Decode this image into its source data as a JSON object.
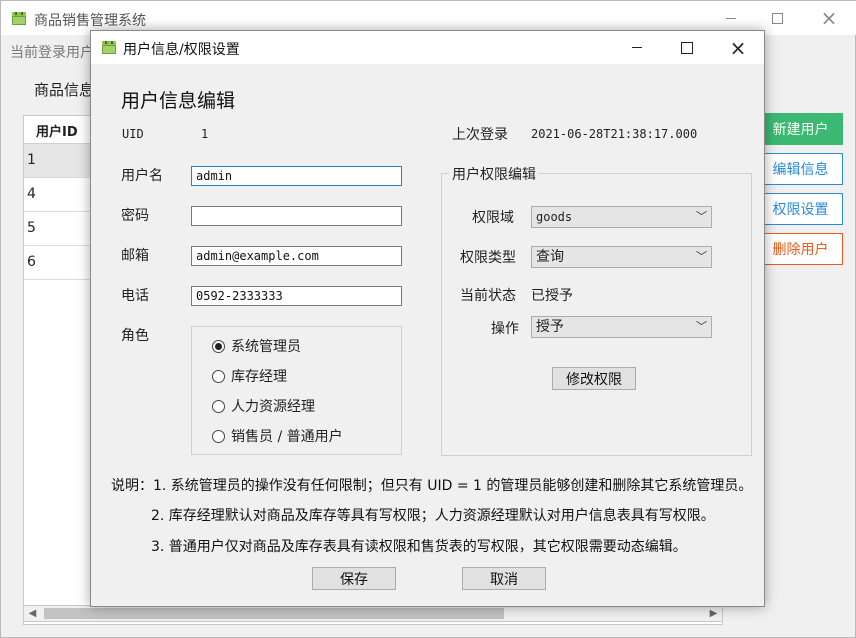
{
  "main": {
    "title": "商品销售管理系统",
    "current_user": "当前登录用户",
    "section_title": "商品信息",
    "table": {
      "header": "用户ID",
      "rows": [
        "1",
        "4",
        "5",
        "6"
      ]
    },
    "buttons": {
      "new_user": "新建用户",
      "edit_info": "编辑信息",
      "perm_settings": "权限设置",
      "delete_user": "删除用户"
    }
  },
  "dialog": {
    "title": "用户信息/权限设置",
    "heading": "用户信息编辑",
    "uid_label": "UID",
    "uid_value": "1",
    "last_login_label": "上次登录",
    "last_login_value": "2021-06-28T21:38:17.000",
    "username_label": "用户名",
    "username_value": "admin",
    "password_label": "密码",
    "password_value": "",
    "email_label": "邮箱",
    "email_value": "admin@example.com",
    "phone_label": "电话",
    "phone_value": "0592-2333333",
    "role_label": "角色",
    "roles": [
      "系统管理员",
      "库存经理",
      "人力资源经理",
      "销售员 / 普通用户"
    ],
    "selected_role_index": 0,
    "perm_group_title": "用户权限编辑",
    "perm_domain_label": "权限域",
    "perm_domain_value": "goods",
    "perm_type_label": "权限类型",
    "perm_type_value": "查询",
    "current_state_label": "当前状态",
    "current_state_value": "已授予",
    "operation_label": "操作",
    "operation_value": "授予",
    "modify_perm_button": "修改权限",
    "notes": [
      "说明：1. 系统管理员的操作没有任何限制；但只有 UID = 1 的管理员能够创建和删除其它系统管理员。",
      "2. 库存经理默认对商品及库存等具有写权限；人力资源经理默认对用户信息表具有写权限。",
      "3. 普通用户仅对商品及库存表具有读权限和售货表的写权限，其它权限需要动态编辑。"
    ],
    "save_button": "保存",
    "cancel_button": "取消"
  }
}
